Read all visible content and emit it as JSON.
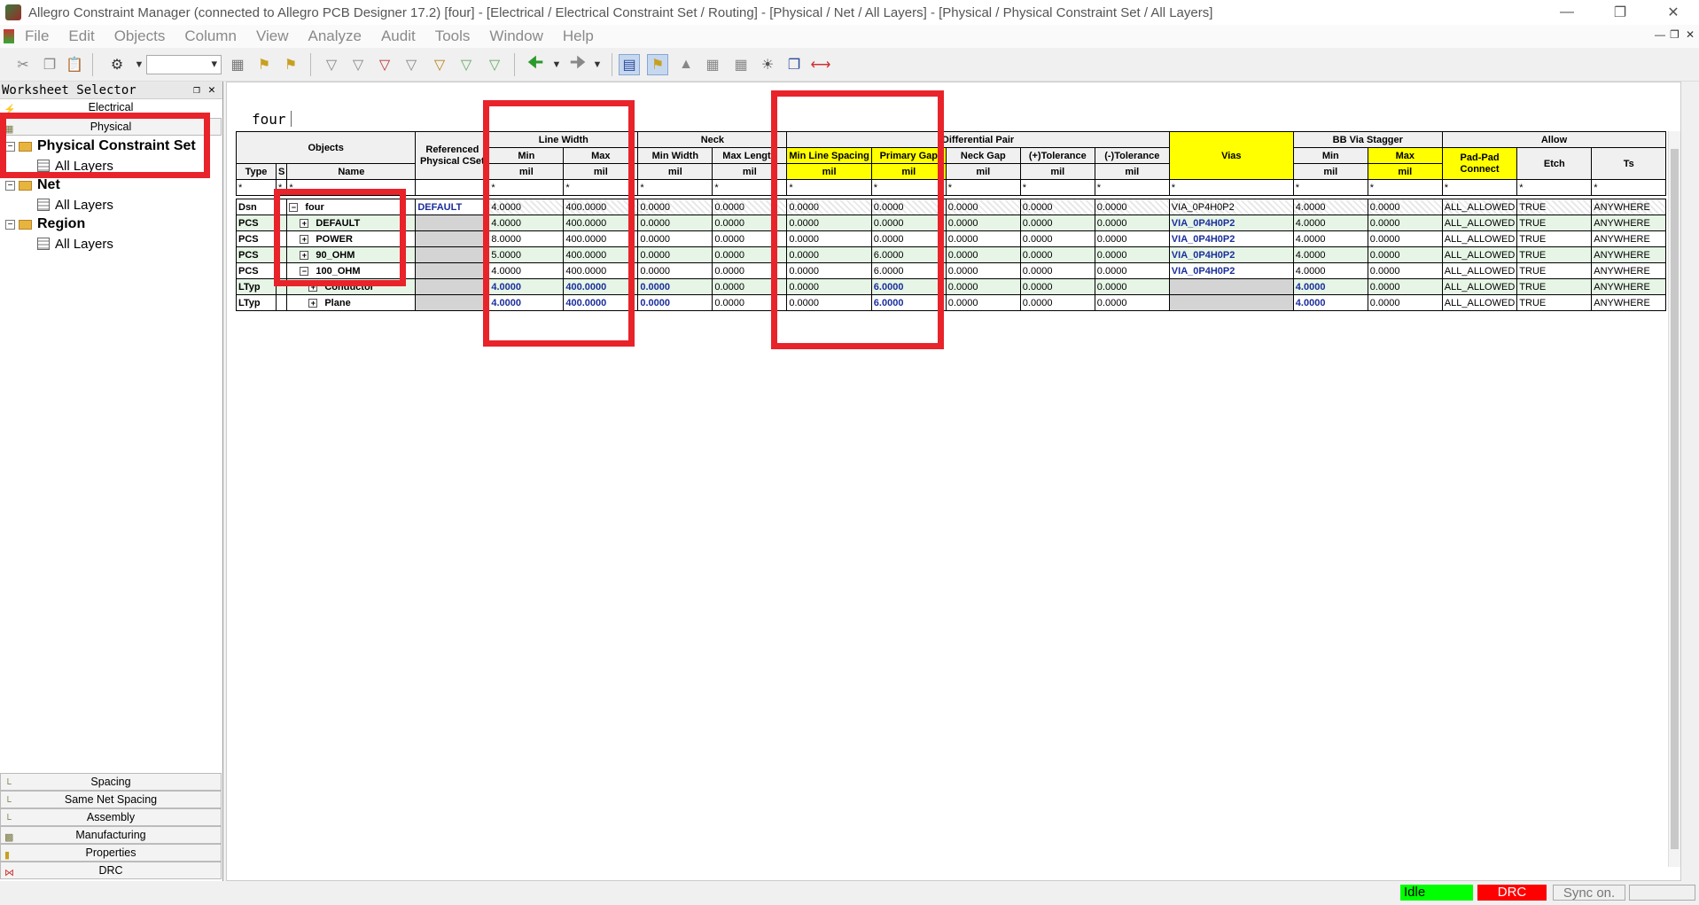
{
  "window": {
    "title": "Allegro Constraint Manager (connected to Allegro PCB Designer 17.2) [four] - [Electrical / Electrical Constraint Set / Routing] - [Physical / Net / All Layers] - [Physical / Physical Constraint Set / All Layers]",
    "minimize": "—",
    "restore": "❐",
    "close": "✕"
  },
  "menu": [
    "File",
    "Edit",
    "Objects",
    "Column",
    "View",
    "Analyze",
    "Audit",
    "Tools",
    "Window",
    "Help"
  ],
  "selector": {
    "header": "Worksheet Selector",
    "electrical": "Electrical",
    "physical": "Physical",
    "tree": {
      "pcs": "Physical Constraint Set",
      "pcs_all": "All Layers",
      "net": "Net",
      "net_all": "All Layers",
      "region": "Region",
      "region_all": "All Layers"
    },
    "bottom_tabs": [
      "Spacing",
      "Same Net Spacing",
      "Assembly",
      "Manufacturing",
      "Properties",
      "DRC"
    ]
  },
  "workspace": {
    "tab": "four"
  },
  "grid": {
    "group_headers": {
      "objects": "Objects",
      "ref": "Referenced Physical CSet",
      "line_width": "Line Width",
      "neck": "Neck",
      "diff_pair": "Differential Pair",
      "vias": "Vias",
      "bb": "BB Via Stagger",
      "allow": "Allow"
    },
    "sub_headers": {
      "type": "Type",
      "s": "S",
      "name": "Name",
      "lw_min": "Min",
      "lw_max": "Max",
      "neck_min": "Min Width",
      "neck_maxlen": "Max Length",
      "dp_minline": "Min Line Spacing",
      "dp_primary": "Primary Gap",
      "dp_neckgap": "Neck Gap",
      "dp_ptol": "(+)Tolerance",
      "dp_ntol": "(-)Tolerance",
      "bb_min": "Min",
      "bb_max": "Max",
      "padpad": "Pad-Pad Connect",
      "etch": "Etch",
      "ts": "Ts"
    },
    "unit": "mil",
    "filter": "*",
    "rows": [
      {
        "type": "Dsn",
        "name": "four",
        "ref": "DEFAULT",
        "lw_min": "4.0000",
        "lw_max": "400.0000",
        "neck_min": "0.0000",
        "neck_maxlen": "0.0000",
        "dp_minline": "0.0000",
        "dp_primary": "0.0000",
        "dp_neckgap": "0.0000",
        "dp_ptol": "0.0000",
        "dp_ntol": "0.0000",
        "vias": "VIA_0P4H0P2",
        "bb_min": "4.0000",
        "bb_max": "0.0000",
        "padpad": "ALL_ALLOWED",
        "etch": "TRUE",
        "ts": "ANYWHERE"
      },
      {
        "type": "PCS",
        "name": "DEFAULT",
        "ref": "",
        "lw_min": "4.0000",
        "lw_max": "400.0000",
        "neck_min": "0.0000",
        "neck_maxlen": "0.0000",
        "dp_minline": "0.0000",
        "dp_primary": "0.0000",
        "dp_neckgap": "0.0000",
        "dp_ptol": "0.0000",
        "dp_ntol": "0.0000",
        "vias": "VIA_0P4H0P2",
        "bb_min": "4.0000",
        "bb_max": "0.0000",
        "padpad": "ALL_ALLOWED",
        "etch": "TRUE",
        "ts": "ANYWHERE"
      },
      {
        "type": "PCS",
        "name": "POWER",
        "ref": "",
        "lw_min": "8.0000",
        "lw_max": "400.0000",
        "neck_min": "0.0000",
        "neck_maxlen": "0.0000",
        "dp_minline": "0.0000",
        "dp_primary": "0.0000",
        "dp_neckgap": "0.0000",
        "dp_ptol": "0.0000",
        "dp_ntol": "0.0000",
        "vias": "VIA_0P4H0P2",
        "bb_min": "4.0000",
        "bb_max": "0.0000",
        "padpad": "ALL_ALLOWED",
        "etch": "TRUE",
        "ts": "ANYWHERE"
      },
      {
        "type": "PCS",
        "name": "90_OHM",
        "ref": "",
        "lw_min": "5.0000",
        "lw_max": "400.0000",
        "neck_min": "0.0000",
        "neck_maxlen": "0.0000",
        "dp_minline": "0.0000",
        "dp_primary": "6.0000",
        "dp_neckgap": "0.0000",
        "dp_ptol": "0.0000",
        "dp_ntol": "0.0000",
        "vias": "VIA_0P4H0P2",
        "bb_min": "4.0000",
        "bb_max": "0.0000",
        "padpad": "ALL_ALLOWED",
        "etch": "TRUE",
        "ts": "ANYWHERE"
      },
      {
        "type": "PCS",
        "name": "100_OHM",
        "ref": "",
        "lw_min": "4.0000",
        "lw_max": "400.0000",
        "neck_min": "0.0000",
        "neck_maxlen": "0.0000",
        "dp_minline": "0.0000",
        "dp_primary": "6.0000",
        "dp_neckgap": "0.0000",
        "dp_ptol": "0.0000",
        "dp_ntol": "0.0000",
        "vias": "VIA_0P4H0P2",
        "bb_min": "4.0000",
        "bb_max": "0.0000",
        "padpad": "ALL_ALLOWED",
        "etch": "TRUE",
        "ts": "ANYWHERE"
      },
      {
        "type": "LTyp",
        "name": "Conductor",
        "ref": "",
        "lw_min": "4.0000",
        "lw_max": "400.0000",
        "neck_min": "0.0000",
        "neck_maxlen": "0.0000",
        "dp_minline": "0.0000",
        "dp_primary": "6.0000",
        "dp_neckgap": "0.0000",
        "dp_ptol": "0.0000",
        "dp_ntol": "0.0000",
        "vias": "",
        "bb_min": "4.0000",
        "bb_max": "0.0000",
        "padpad": "ALL_ALLOWED",
        "etch": "TRUE",
        "ts": "ANYWHERE"
      },
      {
        "type": "LTyp",
        "name": "Plane",
        "ref": "",
        "lw_min": "4.0000",
        "lw_max": "400.0000",
        "neck_min": "0.0000",
        "neck_maxlen": "0.0000",
        "dp_minline": "0.0000",
        "dp_primary": "6.0000",
        "dp_neckgap": "0.0000",
        "dp_ptol": "0.0000",
        "dp_ntol": "0.0000",
        "vias": "",
        "bb_min": "4.0000",
        "bb_max": "0.0000",
        "padpad": "ALL_ALLOWED",
        "etch": "TRUE",
        "ts": "ANYWHERE"
      }
    ]
  },
  "status": {
    "idle": "Idle",
    "drc": "DRC",
    "sync": "Sync on."
  },
  "colors": {
    "highlight": "#e8232a",
    "yellow_header": "#ffff00",
    "status_green": "#00ff00",
    "status_red": "#ff0000"
  }
}
